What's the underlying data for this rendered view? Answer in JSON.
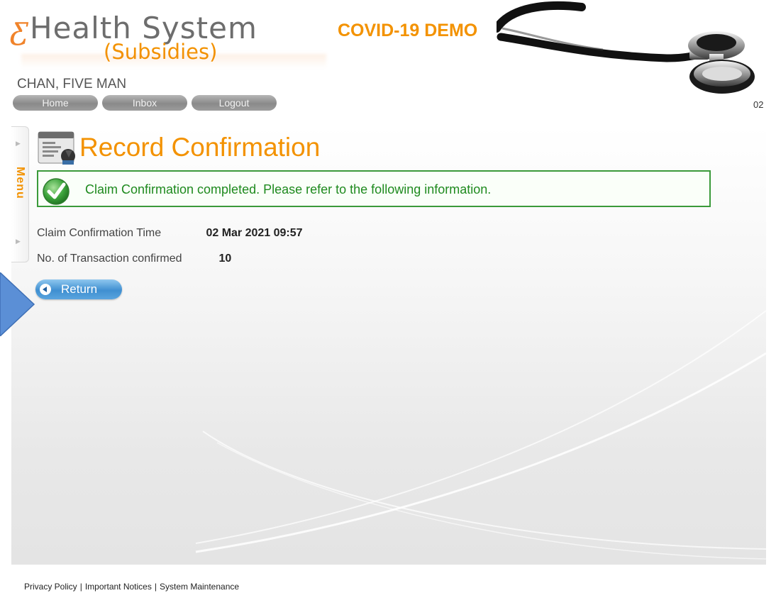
{
  "header": {
    "logo_prefix": "ƹ",
    "logo_name": "Health System",
    "logo_badge": "COVID-19 DEMO",
    "logo_sub": "(Subsidies)",
    "user_name": "CHAN, FIVE MAN",
    "date_corner": "02"
  },
  "nav": {
    "home_label": "Home",
    "inbox_label": "Inbox",
    "logout_label": "Logout"
  },
  "side_menu": {
    "label": "Menu"
  },
  "page": {
    "title": "Record Confirmation",
    "message": "Claim Confirmation completed. Please refer to the following information.",
    "info": [
      {
        "label": "Claim Confirmation Time",
        "value": "02 Mar 2021 09:57"
      },
      {
        "label": "No. of Transaction confirmed",
        "value": "10"
      }
    ],
    "return_label": "Return"
  },
  "footer": {
    "links": [
      "Privacy Policy",
      "Important Notices",
      "System Maintenance"
    ],
    "separator": "|"
  },
  "colors": {
    "accent_orange": "#f39200",
    "success_green": "#1e8a1e",
    "return_blue": "#3f8fd1",
    "pointer_blue": "#5b8fd6"
  },
  "icons": {
    "page_icon": "record-document-icon",
    "message_icon": "check-circle-icon",
    "return_icon": "arrow-left-circle-icon",
    "header_image": "stethoscope-icon"
  }
}
